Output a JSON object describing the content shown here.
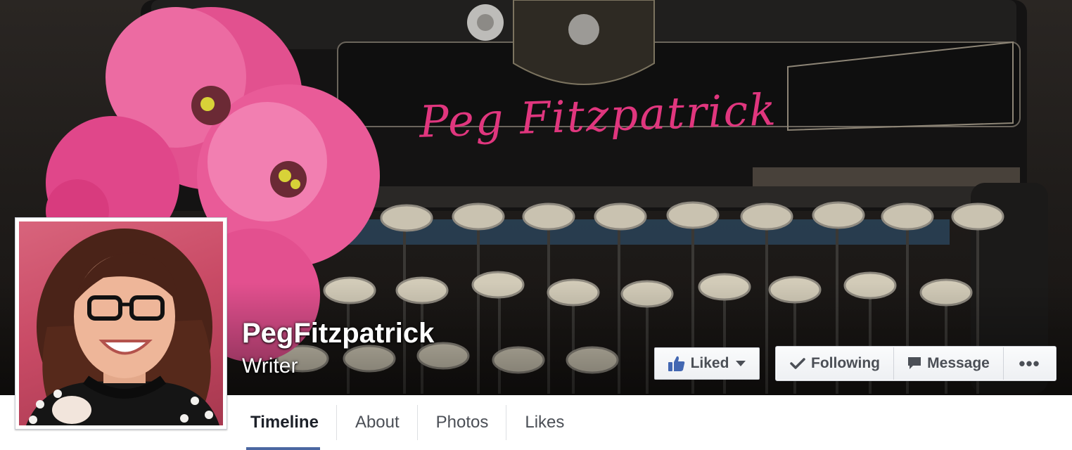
{
  "cover": {
    "script_text": "Peg Fitzpatrick",
    "accent_pink": "#e0367e"
  },
  "profile": {
    "name": "PegFitzpatrick",
    "category": "Writer"
  },
  "actions": {
    "liked_label": "Liked",
    "following_label": "Following",
    "message_label": "Message",
    "more_label": "•••"
  },
  "tabs": [
    {
      "label": "Timeline",
      "active": true
    },
    {
      "label": "About",
      "active": false
    },
    {
      "label": "Photos",
      "active": false
    },
    {
      "label": "Likes",
      "active": false
    }
  ],
  "colors": {
    "facebook_blue": "#4b67a1",
    "like_icon_blue": "#4267b2",
    "button_text": "#4b4f56"
  },
  "icons": {
    "liked": "thumbs-up-icon",
    "following": "check-icon",
    "message": "speech-bubble-icon",
    "more": "more-dots-icon",
    "liked_dropdown": "caret-down-icon"
  }
}
